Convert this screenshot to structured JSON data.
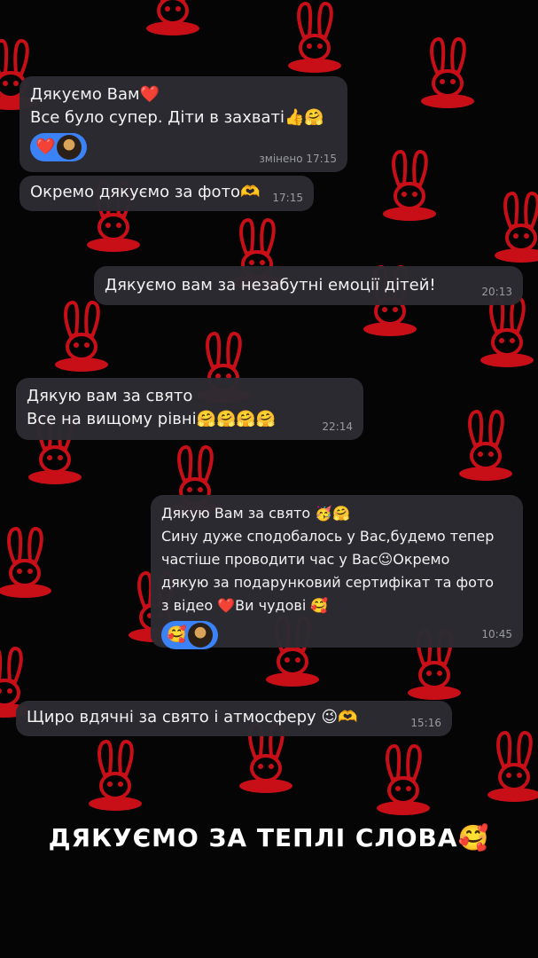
{
  "messages": [
    {
      "lines": [
        "Дякуємо Вам❤️",
        "Все було супер. Діти в захваті👍🤗"
      ],
      "time": "змінено 17:15",
      "reaction_emoji": "❤️"
    },
    {
      "lines": [
        "Окремо дякуємо за фото🫶"
      ],
      "time": "17:15"
    },
    {
      "lines": [
        "Дякуємо вам за незабутні емоції дітей!"
      ],
      "time": "20:13"
    },
    {
      "lines": [
        "Дякую вам за свято",
        "Все на вищому рівні🤗🤗🤗🤗"
      ],
      "time": "22:14"
    },
    {
      "lines": [
        "Дякую Вам за свято 🥳🤗",
        "Сину дуже сподобалось у Вас,будемо тепер",
        "частіше проводити час у Вас😉Окремо",
        "дякую за подарунковий сертифікат та фото",
        "з відео ❤️Ви чудові 🥰"
      ],
      "time": "10:45",
      "reaction_emoji": "🥰"
    },
    {
      "lines": [
        "Щиро вдячні за свято і атмосферу 😉🫶"
      ],
      "time": "15:16"
    }
  ],
  "caption": "ДЯКУЄМО ЗА ТЕПЛІ СЛОВА🥰",
  "colors": {
    "background": "#050505",
    "pattern": "#d3101a",
    "bubble": "#2c2c32",
    "reaction": "#3b82f6"
  },
  "icons": [
    "rabbit-hat-icon",
    "avatar-icon"
  ]
}
